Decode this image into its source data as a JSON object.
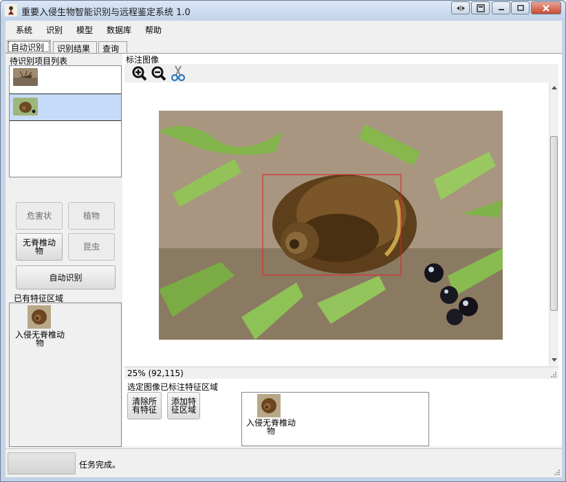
{
  "window": {
    "title": "重要入侵生物智能识别与远程鉴定系统 1.0"
  },
  "menu": [
    "系统",
    "识别",
    "模型",
    "数据库",
    "帮助"
  ],
  "tabs": [
    "自动识别",
    "识别结果",
    "查询"
  ],
  "left": {
    "queue_label": "待识别项目列表",
    "category_buttons": {
      "hazard": "危害状",
      "plant": "植物",
      "invertebrate": "无脊椎动物",
      "insect": "昆虫"
    },
    "auto_button": "自动识别",
    "existing_label": "已有特征区域",
    "existing_item": "入侵无脊椎动物"
  },
  "image_panel": {
    "label": "标注图像",
    "zoom_info": "25%  (92,115)"
  },
  "bottom": {
    "label": "选定图像已标注特征区域",
    "clear_button": "清除所有特征",
    "add_button": "添加特征区域",
    "region_item": "入侵无脊椎动物"
  },
  "status": {
    "text": "任务完成。"
  },
  "colors": {
    "selection": "#c5dbf7",
    "annotation_box": "#e02020",
    "title_bar": "#c4d4e6"
  },
  "icons": [
    "zoom-in-icon",
    "zoom-out-icon",
    "scissors-icon",
    "snail-app-icon"
  ]
}
